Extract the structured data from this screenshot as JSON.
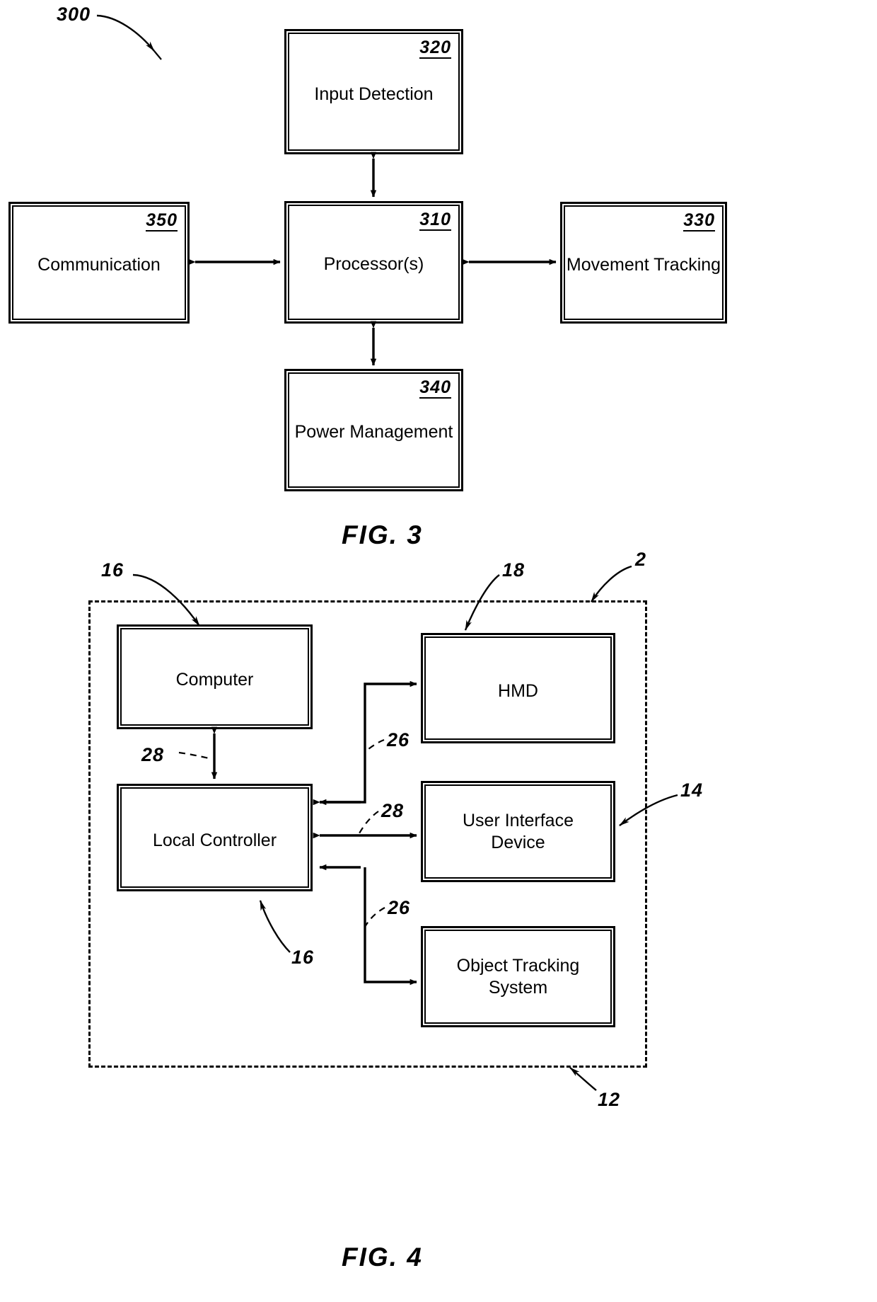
{
  "figures": [
    {
      "id": "fig3",
      "caption": "FIG. 3",
      "system_ref": "300",
      "blocks": [
        {
          "ref": "320",
          "label": "Input Detection"
        },
        {
          "ref": "350",
          "label": "Communication"
        },
        {
          "ref": "310",
          "label": "Processor(s)"
        },
        {
          "ref": "330",
          "label": "Movement Tracking"
        },
        {
          "ref": "340",
          "label": "Power Management"
        }
      ],
      "connections": [
        {
          "from": "310",
          "to": "320",
          "style": "bidirectional"
        },
        {
          "from": "310",
          "to": "350",
          "style": "bidirectional"
        },
        {
          "from": "310",
          "to": "330",
          "style": "bidirectional"
        },
        {
          "from": "310",
          "to": "340",
          "style": "bidirectional"
        }
      ]
    },
    {
      "id": "fig4",
      "caption": "FIG. 4",
      "system_ref": "2",
      "boundary_ref": "12",
      "blocks": [
        {
          "ref": "16",
          "label": "Computer"
        },
        {
          "ref": "18",
          "label": "HMD"
        },
        {
          "ref": "16",
          "label": "Local Controller"
        },
        {
          "ref": "14",
          "label_line1": "User Interface",
          "label_line2": "Device"
        },
        {
          "ref": "",
          "label_line1": "Object Tracking",
          "label_line2": "System"
        }
      ],
      "leader_labels": [
        {
          "text": "16",
          "target": "Computer"
        },
        {
          "text": "18",
          "target": "HMD"
        },
        {
          "text": "2",
          "target": "system boundary"
        },
        {
          "text": "28",
          "target": "Computer to Local Controller link"
        },
        {
          "text": "26",
          "target": "Local Controller to HMD link"
        },
        {
          "text": "28",
          "target": "Local Controller to User Interface Device link"
        },
        {
          "text": "14",
          "target": "User Interface Device"
        },
        {
          "text": "16",
          "target": "Local Controller"
        },
        {
          "text": "26",
          "target": "Local Controller to Object Tracking System link"
        },
        {
          "text": "12",
          "target": "system boundary"
        }
      ]
    }
  ],
  "colors": {
    "ink": "#000000",
    "paper": "#ffffff"
  }
}
